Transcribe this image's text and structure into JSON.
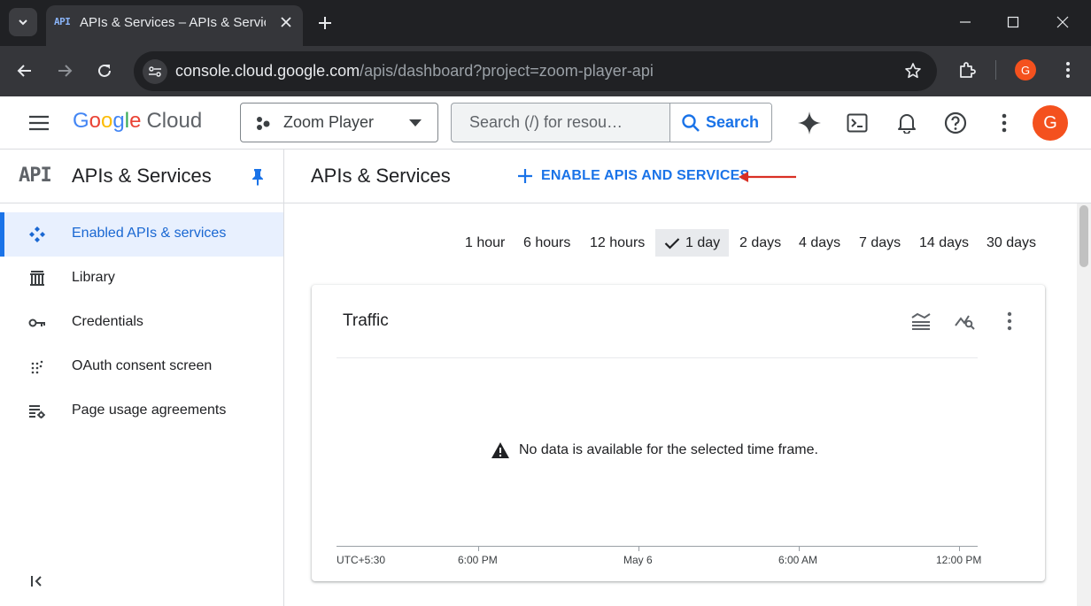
{
  "browser": {
    "tab_title": "APIs & Services – APIs & Services",
    "tab_favicon": "API",
    "url_host": "console.cloud.google.com",
    "url_path": "/apis/dashboard?project=zoom-player-api",
    "profile_initial": "G"
  },
  "header": {
    "logo_google": "Google",
    "logo_cloud": "Cloud",
    "project_name": "Zoom Player",
    "search_placeholder": "Search (/) for resou…",
    "search_button": "Search",
    "avatar_initial": "G"
  },
  "sidebar": {
    "logo": "API",
    "title": "APIs & Services",
    "items": [
      {
        "label": "Enabled APIs & services",
        "icon": "enabled-apis-icon",
        "active": true
      },
      {
        "label": "Library",
        "icon": "library-icon"
      },
      {
        "label": "Credentials",
        "icon": "key-icon"
      },
      {
        "label": "OAuth consent screen",
        "icon": "oauth-icon"
      },
      {
        "label": "Page usage agreements",
        "icon": "settings-list-icon"
      }
    ],
    "collapse_glyph": "<|"
  },
  "main": {
    "title": "APIs & Services",
    "enable_button": "ENABLE APIS AND SERVICES",
    "time_ranges": [
      "1 hour",
      "6 hours",
      "12 hours",
      "1 day",
      "2 days",
      "4 days",
      "7 days",
      "14 days",
      "30 days"
    ],
    "selected_range": "1 day",
    "card": {
      "title": "Traffic",
      "empty_message": "No data is available for the selected time frame.",
      "axis_labels": [
        "UTC+5:30",
        "6:00 PM",
        "May 6",
        "6:00 AM",
        "12:00 PM"
      ]
    }
  },
  "colors": {
    "accent": "#1a73e8",
    "avatar": "#f4511e",
    "arrow": "#d93025"
  }
}
